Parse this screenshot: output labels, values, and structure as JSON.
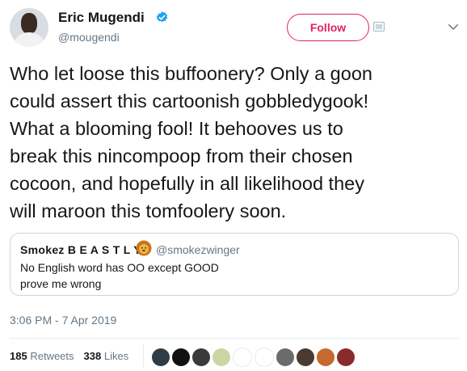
{
  "author": {
    "name": "Eric Mugendi",
    "handle": "@mougendi",
    "verified": true
  },
  "follow_label": "Follow",
  "tweet_lines": [
    "Who let loose this buffoonery? Only a goon",
    "could assert this cartoonish gobbledygook!",
    "What a blooming fool! It behooves us to",
    "break this nincompoop from their chosen",
    "cocoon, and hopefully in all likelihood they",
    "will maroon this tomfoolery soon."
  ],
  "quote": {
    "name": "Smokez B E A S T L Y",
    "emoji": "lion-face",
    "handle": "@smokezwinger",
    "lines": [
      "No English word has OO except GOOD",
      "prove me wrong"
    ]
  },
  "timestamp": "3:06 PM - 7 Apr 2019",
  "stats": {
    "retweets_count": "185",
    "retweets_label": "Retweets",
    "likes_count": "338",
    "likes_label": "Likes"
  },
  "colors": {
    "follow_accent": "#e0245e",
    "verified_blue": "#1da1f2",
    "secondary_text": "#657786"
  },
  "liker_avatars": [
    {
      "icon": "person-avatar",
      "color": "#2f3b45"
    },
    {
      "icon": "dark-photo-avatar",
      "color": "#111111"
    },
    {
      "icon": "text-image-avatar",
      "color": "#3a3a3a"
    },
    {
      "icon": "green-document-avatar",
      "color": "#c9d6a3"
    },
    {
      "icon": "crown-avatar",
      "color": "#ffffff"
    },
    {
      "icon": "red-logo-avatar",
      "color": "#ffffff"
    },
    {
      "icon": "person-avatar",
      "color": "#6b6b6b"
    },
    {
      "icon": "glasses-person-avatar",
      "color": "#4a3a30"
    },
    {
      "icon": "orange-person-avatar",
      "color": "#c46a2e"
    },
    {
      "icon": "red-person-avatar",
      "color": "#8a2b2b"
    }
  ]
}
